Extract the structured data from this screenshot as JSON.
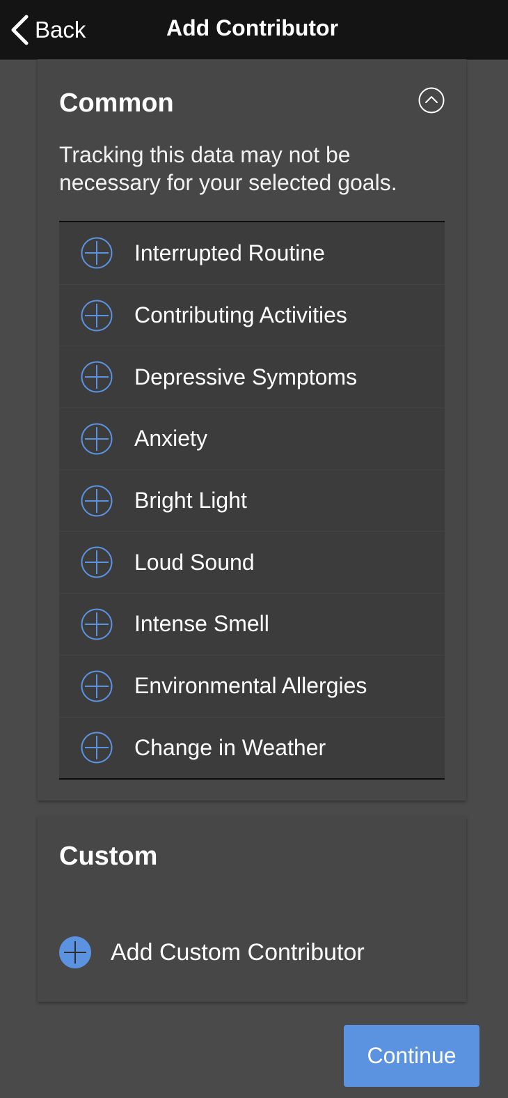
{
  "header": {
    "back_label": "Back",
    "title": "Add Contributor"
  },
  "common": {
    "title": "Common",
    "description": "Tracking this data may not be necessary for your selected goals.",
    "collapse_icon": "chevron-up-circle-icon",
    "items": [
      {
        "label": "Interrupted Routine",
        "icon": "plus-circle-icon"
      },
      {
        "label": "Contributing Activities",
        "icon": "plus-circle-icon"
      },
      {
        "label": "Depressive Symptoms",
        "icon": "plus-circle-icon"
      },
      {
        "label": "Anxiety",
        "icon": "plus-circle-icon"
      },
      {
        "label": "Bright Light",
        "icon": "plus-circle-icon"
      },
      {
        "label": "Loud Sound",
        "icon": "plus-circle-icon"
      },
      {
        "label": "Intense Smell",
        "icon": "plus-circle-icon"
      },
      {
        "label": "Environmental Allergies",
        "icon": "plus-circle-icon"
      },
      {
        "label": "Change in Weather",
        "icon": "plus-circle-icon"
      }
    ]
  },
  "custom": {
    "title": "Custom",
    "add_label": "Add Custom Contributor",
    "add_icon": "plus-filled-circle-icon"
  },
  "footer": {
    "continue_label": "Continue"
  },
  "colors": {
    "accent": "#5b93e0",
    "navbar": "#141414",
    "background": "#4a4a4a",
    "card": "#474747",
    "list": "#3c3c3c"
  }
}
